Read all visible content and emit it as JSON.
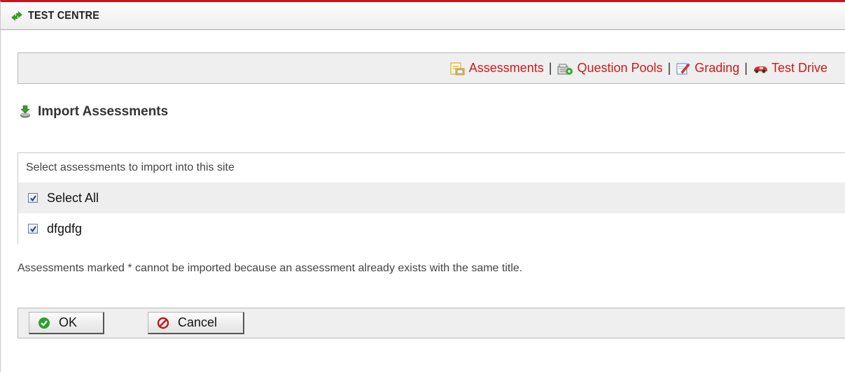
{
  "tool": {
    "title": "TEST CENTRE"
  },
  "nav": {
    "items": [
      {
        "label": "Assessments",
        "icon": "assessments-icon"
      },
      {
        "label": "Question Pools",
        "icon": "question-pools-icon"
      },
      {
        "label": "Grading",
        "icon": "grading-icon"
      },
      {
        "label": "Test Drive",
        "icon": "test-drive-icon"
      }
    ],
    "separator": "|"
  },
  "page": {
    "heading": "Import Assessments"
  },
  "table": {
    "header": "Select assessments to import into this site",
    "select_all": {
      "label": "Select All",
      "checked": true
    },
    "rows": [
      {
        "label": "dfgdfg",
        "checked": true
      }
    ]
  },
  "note": "Assessments marked * cannot be imported because an assessment already exists with the same title.",
  "buttons": {
    "ok": "OK",
    "cancel": "Cancel"
  },
  "colors": {
    "accent_red": "#c4161c",
    "link_red": "#cc1a1a",
    "ok_green": "#2f9e2f",
    "cancel_red": "#c0161c"
  }
}
